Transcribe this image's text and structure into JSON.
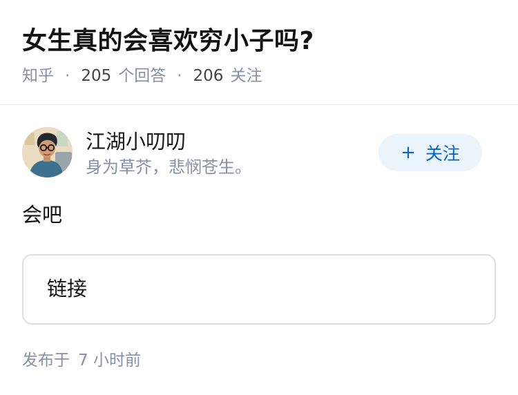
{
  "question": {
    "title": "女生真的会喜欢穷小子吗?",
    "source": "知乎",
    "answer_count": "205",
    "answer_label": "个回答",
    "follower_count": "206",
    "follower_label": "关注",
    "separator": "·"
  },
  "answer": {
    "author": {
      "name": "江湖小叨叨",
      "bio": "身为草芥，悲悯苍生。",
      "avatar_icon": "avatar-illustration"
    },
    "follow_button": {
      "icon": "+",
      "label": "关注"
    },
    "content": "会吧",
    "link_card": {
      "label": "链接"
    },
    "published": {
      "prefix": "发布于",
      "time": "7 小时前"
    }
  },
  "colors": {
    "title": "#121212",
    "meta": "#8590a6",
    "accent": "#0066cc",
    "follow_bg": "#ebf3fb",
    "card_border": "#e0e0e0"
  }
}
